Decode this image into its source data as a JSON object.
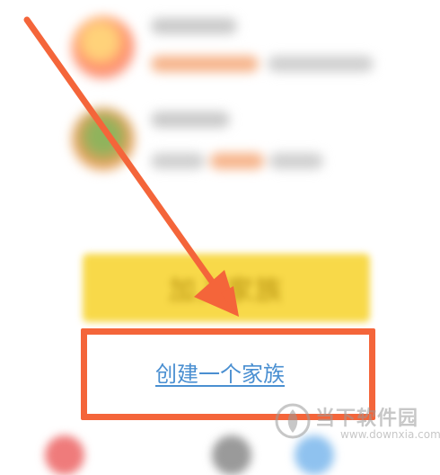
{
  "content": {
    "join_button_label": "加入家族",
    "create_family_link": "创建一个家族"
  },
  "watermark": {
    "site_name": "当下软件园",
    "site_url": "www.downxia.com"
  },
  "colors": {
    "highlight": "#f4653a",
    "join_button": "#f8d949",
    "link": "#4a8fd1"
  },
  "icons": [
    "arrow-annotation-icon",
    "downxia-logo-icon"
  ]
}
